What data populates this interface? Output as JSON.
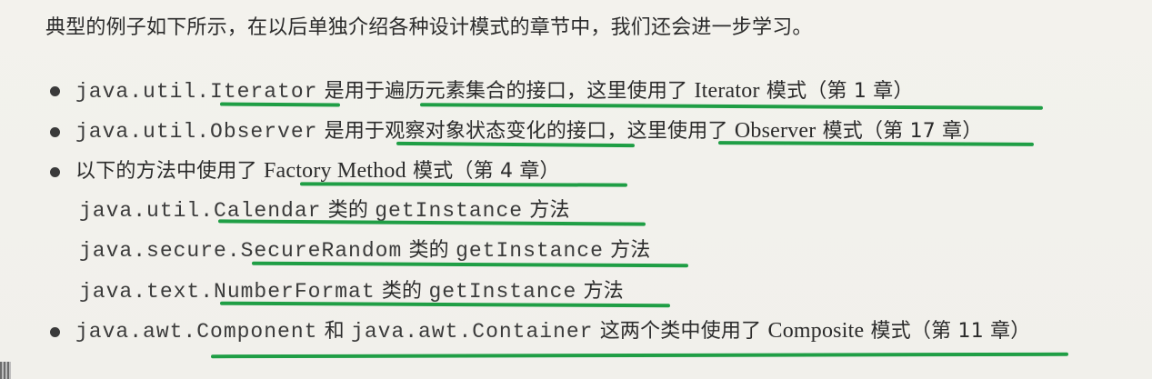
{
  "intro": "典型的例子如下所示，在以后单独介绍各种设计模式的章节中，我们还会进一步学习。",
  "item1": {
    "code": "java.util.Iterator",
    "text": " 是用于遍历元素集合的接口，这里使用了 ",
    "pattern": "Iterator",
    "tail": " 模式（第 1 章）"
  },
  "item2": {
    "code": "java.util.Observer",
    "text": " 是用于观察对象状态变化的接口，这里使用了 ",
    "pattern": "Observer",
    "tail": " 模式（第 17 章）"
  },
  "item3": {
    "text": "以下的方法中使用了 ",
    "pattern": "Factory Method",
    "tail": " 模式（第 4 章）",
    "subs": [
      {
        "code": "java.util.Calendar",
        "lei": " 类的 ",
        "method": "getInstance",
        "suffix": " 方法"
      },
      {
        "code": "java.secure.SecureRandom",
        "lei": " 类的 ",
        "method": "getInstance",
        "suffix": " 方法"
      },
      {
        "code": "java.text.NumberFormat",
        "lei": " 类的 ",
        "method": "getInstance",
        "suffix": " 方法"
      }
    ]
  },
  "item4": {
    "code1": "java.awt.Component",
    "he": " 和 ",
    "code2": "java.awt.Container",
    "text": " 这两个类中使用了 ",
    "pattern": "Composite",
    "tail": " 模式（第 11 章）"
  },
  "colors": {
    "underline": "#1f9e45",
    "paper": "#f2f1ec",
    "text": "#2b2b2b"
  }
}
